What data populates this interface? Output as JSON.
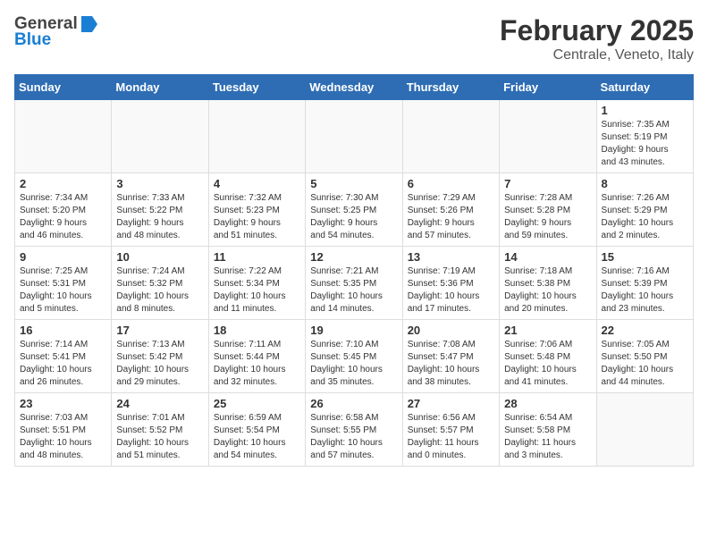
{
  "logo": {
    "general": "General",
    "blue": "Blue"
  },
  "header": {
    "month": "February 2025",
    "location": "Centrale, Veneto, Italy"
  },
  "weekdays": [
    "Sunday",
    "Monday",
    "Tuesday",
    "Wednesday",
    "Thursday",
    "Friday",
    "Saturday"
  ],
  "weeks": [
    [
      {
        "day": "",
        "info": ""
      },
      {
        "day": "",
        "info": ""
      },
      {
        "day": "",
        "info": ""
      },
      {
        "day": "",
        "info": ""
      },
      {
        "day": "",
        "info": ""
      },
      {
        "day": "",
        "info": ""
      },
      {
        "day": "1",
        "info": "Sunrise: 7:35 AM\nSunset: 5:19 PM\nDaylight: 9 hours\nand 43 minutes."
      }
    ],
    [
      {
        "day": "2",
        "info": "Sunrise: 7:34 AM\nSunset: 5:20 PM\nDaylight: 9 hours\nand 46 minutes."
      },
      {
        "day": "3",
        "info": "Sunrise: 7:33 AM\nSunset: 5:22 PM\nDaylight: 9 hours\nand 48 minutes."
      },
      {
        "day": "4",
        "info": "Sunrise: 7:32 AM\nSunset: 5:23 PM\nDaylight: 9 hours\nand 51 minutes."
      },
      {
        "day": "5",
        "info": "Sunrise: 7:30 AM\nSunset: 5:25 PM\nDaylight: 9 hours\nand 54 minutes."
      },
      {
        "day": "6",
        "info": "Sunrise: 7:29 AM\nSunset: 5:26 PM\nDaylight: 9 hours\nand 57 minutes."
      },
      {
        "day": "7",
        "info": "Sunrise: 7:28 AM\nSunset: 5:28 PM\nDaylight: 9 hours\nand 59 minutes."
      },
      {
        "day": "8",
        "info": "Sunrise: 7:26 AM\nSunset: 5:29 PM\nDaylight: 10 hours\nand 2 minutes."
      }
    ],
    [
      {
        "day": "9",
        "info": "Sunrise: 7:25 AM\nSunset: 5:31 PM\nDaylight: 10 hours\nand 5 minutes."
      },
      {
        "day": "10",
        "info": "Sunrise: 7:24 AM\nSunset: 5:32 PM\nDaylight: 10 hours\nand 8 minutes."
      },
      {
        "day": "11",
        "info": "Sunrise: 7:22 AM\nSunset: 5:34 PM\nDaylight: 10 hours\nand 11 minutes."
      },
      {
        "day": "12",
        "info": "Sunrise: 7:21 AM\nSunset: 5:35 PM\nDaylight: 10 hours\nand 14 minutes."
      },
      {
        "day": "13",
        "info": "Sunrise: 7:19 AM\nSunset: 5:36 PM\nDaylight: 10 hours\nand 17 minutes."
      },
      {
        "day": "14",
        "info": "Sunrise: 7:18 AM\nSunset: 5:38 PM\nDaylight: 10 hours\nand 20 minutes."
      },
      {
        "day": "15",
        "info": "Sunrise: 7:16 AM\nSunset: 5:39 PM\nDaylight: 10 hours\nand 23 minutes."
      }
    ],
    [
      {
        "day": "16",
        "info": "Sunrise: 7:14 AM\nSunset: 5:41 PM\nDaylight: 10 hours\nand 26 minutes."
      },
      {
        "day": "17",
        "info": "Sunrise: 7:13 AM\nSunset: 5:42 PM\nDaylight: 10 hours\nand 29 minutes."
      },
      {
        "day": "18",
        "info": "Sunrise: 7:11 AM\nSunset: 5:44 PM\nDaylight: 10 hours\nand 32 minutes."
      },
      {
        "day": "19",
        "info": "Sunrise: 7:10 AM\nSunset: 5:45 PM\nDaylight: 10 hours\nand 35 minutes."
      },
      {
        "day": "20",
        "info": "Sunrise: 7:08 AM\nSunset: 5:47 PM\nDaylight: 10 hours\nand 38 minutes."
      },
      {
        "day": "21",
        "info": "Sunrise: 7:06 AM\nSunset: 5:48 PM\nDaylight: 10 hours\nand 41 minutes."
      },
      {
        "day": "22",
        "info": "Sunrise: 7:05 AM\nSunset: 5:50 PM\nDaylight: 10 hours\nand 44 minutes."
      }
    ],
    [
      {
        "day": "23",
        "info": "Sunrise: 7:03 AM\nSunset: 5:51 PM\nDaylight: 10 hours\nand 48 minutes."
      },
      {
        "day": "24",
        "info": "Sunrise: 7:01 AM\nSunset: 5:52 PM\nDaylight: 10 hours\nand 51 minutes."
      },
      {
        "day": "25",
        "info": "Sunrise: 6:59 AM\nSunset: 5:54 PM\nDaylight: 10 hours\nand 54 minutes."
      },
      {
        "day": "26",
        "info": "Sunrise: 6:58 AM\nSunset: 5:55 PM\nDaylight: 10 hours\nand 57 minutes."
      },
      {
        "day": "27",
        "info": "Sunrise: 6:56 AM\nSunset: 5:57 PM\nDaylight: 11 hours\nand 0 minutes."
      },
      {
        "day": "28",
        "info": "Sunrise: 6:54 AM\nSunset: 5:58 PM\nDaylight: 11 hours\nand 3 minutes."
      },
      {
        "day": "",
        "info": ""
      }
    ]
  ]
}
